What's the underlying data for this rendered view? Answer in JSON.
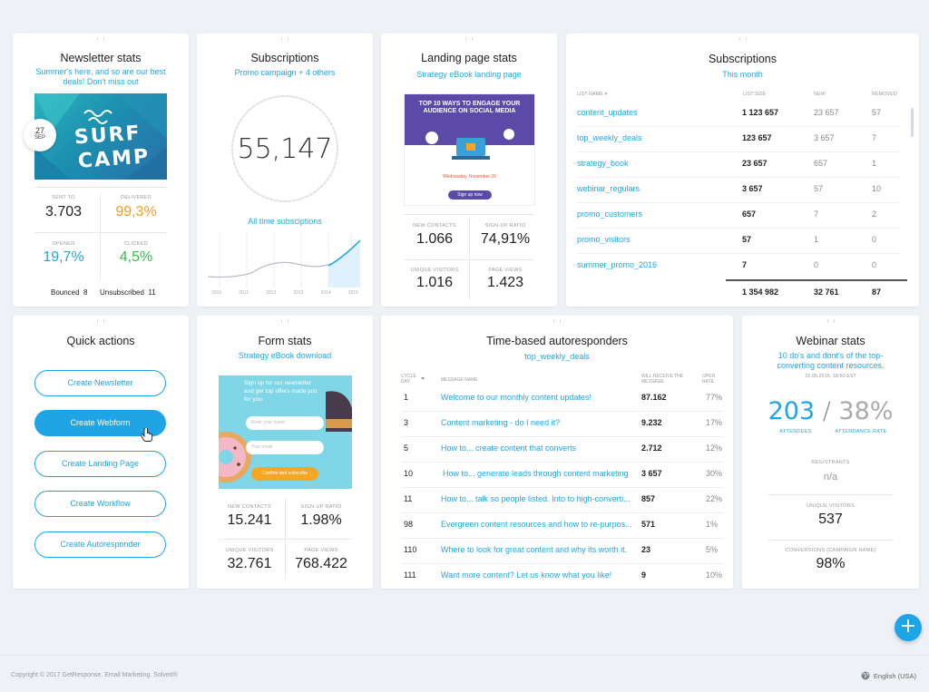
{
  "newsletter": {
    "title": "Newsletter stats",
    "subtitle": "Summer's here, and so are our best deals! Don't miss out",
    "date_day": "27",
    "date_month": "SEP",
    "image_text_1": "SURF",
    "image_text_2": "CAMP",
    "sent_label": "SENT TO",
    "sent_value": "3.703",
    "delivered_label": "DELIVERED",
    "delivered_value": "99,3%",
    "opened_label": "OPENED",
    "opened_value": "19,7%",
    "clicked_label": "CLICKED",
    "clicked_value": "4,5%",
    "bounced": "Bounced  8",
    "unsubscribed": "Unsubscribed  11",
    "colors": {
      "delivered": "#f39c1f",
      "opened": "#1fa5e6",
      "clicked": "#2fbf4a"
    }
  },
  "subs_chart": {
    "title": "Subscriptions",
    "subtitle": "Promo campaign + 4 others",
    "total": "55,147",
    "caption": "All time subsciptions",
    "years": [
      "2010",
      "2011",
      "2012",
      "2013",
      "2014",
      "2015"
    ]
  },
  "landing": {
    "title": "Landing page stats",
    "subtitle": "Strategy eBook landing page",
    "preview_heading": "TOP 10 WAYS TO ENGAGE YOUR AUDIENCE ON SOCIAL MEDIA",
    "preview_date": "Wednesday, November 26",
    "preview_button": "Sign up now",
    "new_contacts_label": "NEW CONTACTS",
    "new_contacts": "1.066",
    "signup_ratio_label": "SIGN-UP RATIO",
    "signup_ratio": "74,91%",
    "unique_visitors_label": "UNIQUE VISITORS",
    "unique_visitors": "1.016",
    "page_views_label": "PAGE VIEWS",
    "page_views": "1.423"
  },
  "subs_table": {
    "title": "Subscriptions",
    "subtitle": "This month",
    "headers": [
      "LIST NAME ▾",
      "LIST SIZE",
      "NEW",
      "REMOVED"
    ],
    "rows": [
      [
        "content_updates",
        "1 123 657",
        "23 657",
        "57"
      ],
      [
        "top_weekly_deals",
        "123 657",
        "3 657",
        "7"
      ],
      [
        "strategy_book",
        "23 657",
        "657",
        "1"
      ],
      [
        "webinar_regulars",
        "3 657",
        "57",
        "10"
      ],
      [
        "promo_customers",
        "657",
        "7",
        "2"
      ],
      [
        "promo_visitors",
        "57",
        "1",
        "0"
      ],
      [
        "summer_promo_2016",
        "7",
        "0",
        "0"
      ]
    ],
    "totals": [
      "1 354 982",
      "32 761",
      "87"
    ]
  },
  "quick": {
    "title": "Quick actions",
    "buttons": [
      "Create Newsletter",
      "Create Webform",
      "Create Landing Page",
      "Create Workflow",
      "Create Autoresponder"
    ]
  },
  "form": {
    "title": "Form stats",
    "subtitle": "Strategy eBook download",
    "preview_text": "Sign up for our newsletter and get top offers made just for you.",
    "preview_name": "Enter your name",
    "preview_email": "Your email",
    "preview_button": "Confirm and subscribe",
    "new_contacts_label": "NEW CONTACTS",
    "new_contacts": "15.241",
    "signup_ratio_label": "SIGN-UP RATIO",
    "signup_ratio": "1.98%",
    "unique_visitors_label": "UNIQUE VISITORS",
    "unique_visitors": "32.761",
    "page_views_label": "PAGE VIEWS",
    "page_views": "768.422"
  },
  "auto": {
    "title": "Time-based autoresponders",
    "subtitle": "top_weekly_deals",
    "headers": [
      "CYCLE DAY",
      "MESSAGE NAME",
      "WILL RECEIVE THE MESSAGE",
      "OPEN RATE"
    ],
    "rows": [
      [
        "1",
        "Welcome to our monthly content updates!",
        "87.162",
        "77%"
      ],
      [
        "3",
        "Content marketing - do I need it?",
        "9.232",
        "17%"
      ],
      [
        "5",
        "How to... create content that converts",
        "2.712",
        "12%"
      ],
      [
        "10",
        "How to... generate leads through content marketing",
        "3 657",
        "30%"
      ],
      [
        "11",
        "How to... talk so people listed. Into to high-converti...",
        "857",
        "22%"
      ],
      [
        "98",
        "Evergreen content resources and how to re-purpos...",
        "571",
        "1%"
      ],
      [
        "110",
        "Where to look for great content and why its worth it.",
        "23",
        "5%"
      ],
      [
        "111",
        "Want more content? Let us know what you like!",
        "9",
        "10%"
      ]
    ]
  },
  "webinar": {
    "title": "Webinar stats",
    "subtitle": "10 do's and dont's of the top-converting content resources.",
    "datetime": "15.05.2016, 18:50 EST",
    "attendees": "203",
    "sep": "/",
    "attendance_rate": "38%",
    "attendees_label": "ATTENDEES",
    "attendance_label": "ATTENDANCE RATE",
    "registrants_label": "REGISTRANTS",
    "registrants": "n/a",
    "unique_visitors_label": "UNIQUE VISITORS",
    "unique_visitors": "537",
    "conversions_label": "CONVERSIONS (CAMPAIGN NAME)",
    "conversions": "98%"
  },
  "footer": {
    "copyright": "Copyright © 2017 GetResponse. Email Marketing. Solved®",
    "language": "English (USA)"
  },
  "fab_label": "+",
  "colors": {
    "accent": "#1fa5e6",
    "background": "#eef1f6"
  }
}
